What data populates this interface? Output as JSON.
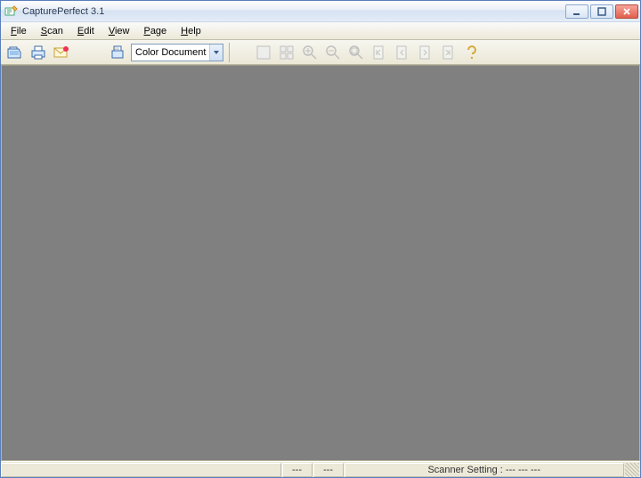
{
  "title": "CapturePerfect 3.1",
  "menu": {
    "file": "File",
    "scan": "Scan",
    "edit": "Edit",
    "view": "View",
    "page": "Page",
    "help": "Help"
  },
  "toolbar": {
    "dropdown_value": "Color Document"
  },
  "status": {
    "left_blank": "",
    "field1": "---",
    "field2": "---",
    "scanner_label": "Scanner Setting :",
    "scanner_value": "---  ---  ---"
  }
}
